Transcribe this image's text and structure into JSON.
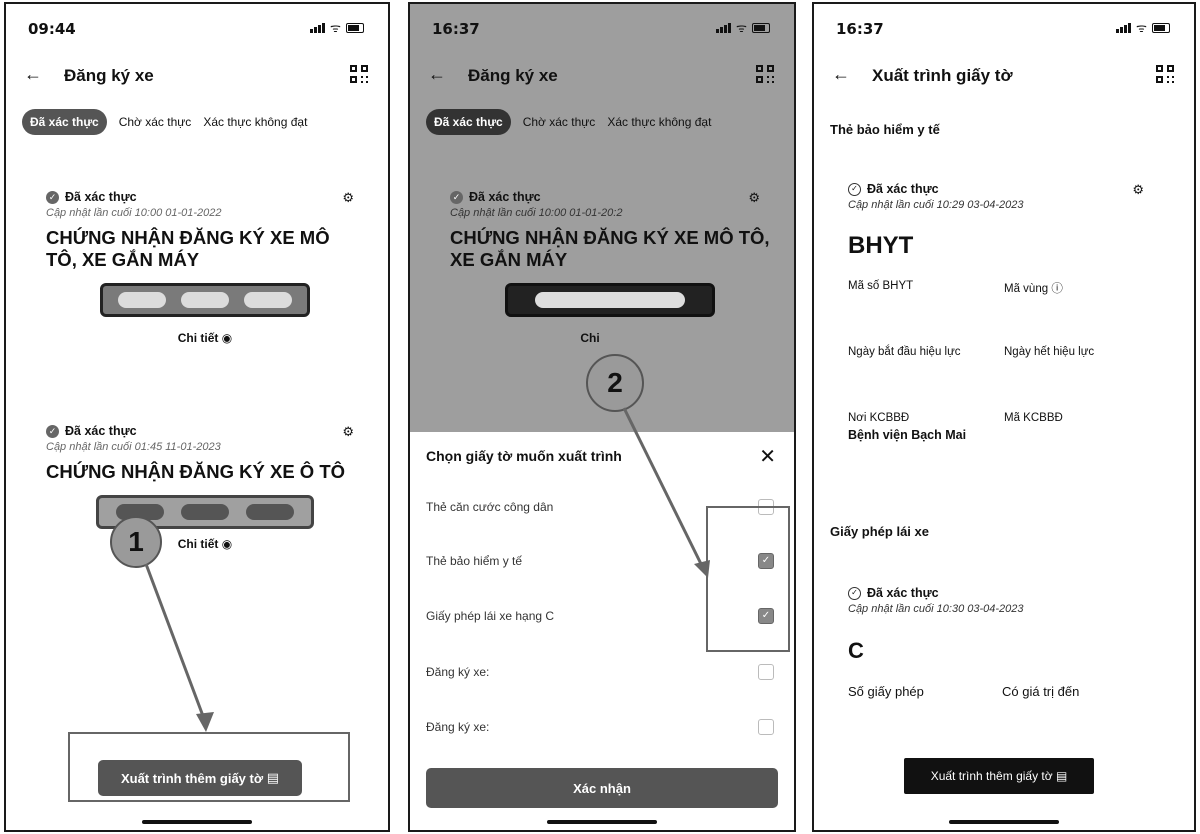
{
  "screen1": {
    "time": "09:44",
    "title": "Đăng ký xe",
    "tabs": [
      "Đã xác thực",
      "Chờ xác thực",
      "Xác thực không đạt"
    ],
    "cards": [
      {
        "status": "Đã xác thực",
        "updated": "Cập nhật lần cuối 10:00 01-01-2022",
        "title": "CHỨNG NHẬN ĐĂNG KÝ XE MÔ TÔ, XE GẮN MÁY",
        "detail": "Chi tiết"
      },
      {
        "status": "Đã xác thực",
        "updated": "Cập nhật lần cuối 01:45 11-01-2023",
        "title": "CHỨNG NHẬN ĐĂNG KÝ XE Ô TÔ",
        "detail": "Chi tiết"
      }
    ],
    "button": "Xuất trình thêm giấy tờ",
    "step": "1"
  },
  "screen2": {
    "time": "16:37",
    "title": "Đăng ký xe",
    "tabs": [
      "Đã xác thực",
      "Chờ xác thực",
      "Xác thực không đạt"
    ],
    "card": {
      "status": "Đã xác thực",
      "updated": "Cập nhật lần cuối 10:00 01-01-20:2",
      "title": "CHỨNG NHẬN ĐĂNG KÝ XE MÔ TÔ, XE GẮN MÁY",
      "detail": "Chi"
    },
    "sheet_title": "Chọn giấy tờ muốn xuất trình",
    "options": [
      {
        "label": "Thẻ căn cước công dân",
        "checked": false
      },
      {
        "label": "Thẻ bảo hiểm y tế",
        "checked": true
      },
      {
        "label": "Giấy phép lái xe hạng C",
        "checked": true
      },
      {
        "label": "Đăng ký xe:",
        "checked": false
      },
      {
        "label": "Đăng ký xe:",
        "checked": false
      }
    ],
    "confirm": "Xác nhận",
    "step": "2"
  },
  "screen3": {
    "time": "16:37",
    "title": "Xuất trình giấy tờ",
    "section1": "Thẻ bảo hiểm y tế",
    "bhyt": {
      "status": "Đã xác thực",
      "updated": "Cập nhật lần cuối 10:29 03-04-2023",
      "name": "BHYT",
      "label_code": "Mã số BHYT",
      "label_region": "Mã vùng",
      "label_start": "Ngày bắt đầu hiệu lực",
      "label_end": "Ngày hết hiệu lực",
      "label_place": "Nơi KCBBĐ",
      "label_place_code": "Mã KCBBĐ",
      "place": "Bệnh viện Bạch Mai"
    },
    "section2": "Giấy phép lái xe",
    "gplx": {
      "status": "Đã xác thực",
      "updated": "Cập nhật lần cuối 10:30 03-04-2023",
      "class": "C",
      "label_number": "Số giấy phép",
      "label_valid": "Có giá trị đến"
    },
    "button": "Xuất trình thêm giấy tờ"
  }
}
